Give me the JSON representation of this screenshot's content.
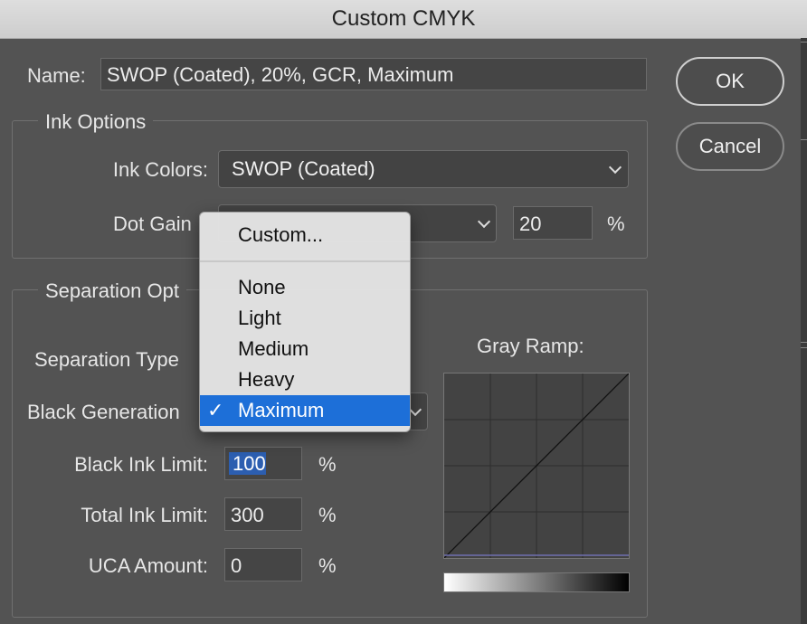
{
  "window": {
    "title": "Custom CMYK"
  },
  "name": {
    "label": "Name:",
    "value": "SWOP (Coated), 20%, GCR, Maximum"
  },
  "buttons": {
    "ok": "OK",
    "cancel": "Cancel"
  },
  "ink_options": {
    "legend": "Ink Options",
    "ink_colors_label": "Ink Colors:",
    "ink_colors_value": "SWOP (Coated)",
    "dot_gain_label": "Dot Gain",
    "dot_gain_value": "20",
    "dot_gain_unit": "%"
  },
  "separation_options": {
    "legend": "Separation Opt",
    "separation_type_label": "Separation Type",
    "black_generation_label": "Black Generation",
    "black_ink_limit_label": "Black Ink Limit:",
    "black_ink_limit_value": "100",
    "total_ink_limit_label": "Total Ink Limit:",
    "total_ink_limit_value": "300",
    "uca_amount_label": "UCA Amount:",
    "uca_amount_value": "0",
    "unit": "%",
    "gray_ramp_label": "Gray Ramp:"
  },
  "dropdown_menu": {
    "items": [
      "Custom...",
      "None",
      "Light",
      "Medium",
      "Heavy",
      "Maximum"
    ],
    "selected": "Maximum",
    "check": "✓"
  },
  "colors": {
    "selection": "#1d6fd8",
    "background": "#535353"
  }
}
